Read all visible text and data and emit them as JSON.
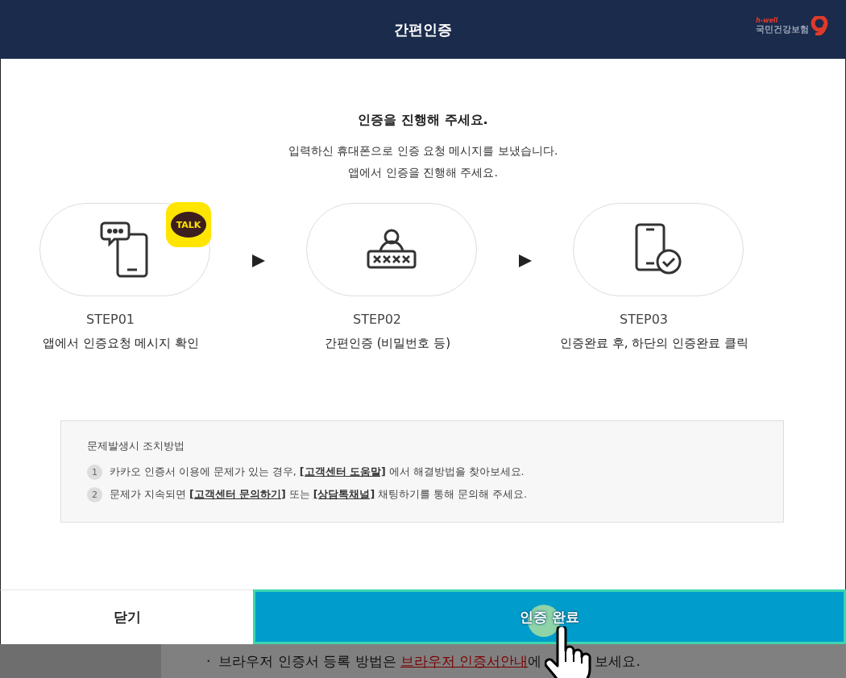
{
  "dialog": {
    "title": "간편인증",
    "logo": {
      "tagline": "h-well",
      "name": "국민건강보험"
    }
  },
  "intro": {
    "heading": "인증을 진행해 주세요.",
    "lines": [
      "입력하신 휴대폰으로 인증 요청 메시지를 보냈습니다.",
      "앱에서 인증을 진행해 주세요."
    ]
  },
  "steps": [
    {
      "kind": "message",
      "badge": "TALK",
      "label": "STEP01",
      "description": "앱에서 인증요청 메시지 확인"
    },
    {
      "kind": "password",
      "label": "STEP02",
      "description": "간편인증 (비밀번호 등)"
    },
    {
      "kind": "check",
      "label": "STEP03",
      "description": "인증완료 후, 하단의 인증완료 클릭"
    }
  ],
  "help": {
    "title": "문제발생시 조치방법",
    "items": [
      {
        "number": "1",
        "segments": [
          {
            "kind": "text",
            "text": "카카오 인증서 이용에 문제가 있는 경우, "
          },
          {
            "kind": "link",
            "text": "[고객센터 도움말]"
          },
          {
            "kind": "text",
            "text": " 에서 해결방법을 찾아보세요."
          }
        ]
      },
      {
        "number": "2",
        "segments": [
          {
            "kind": "text",
            "text": "문제가 지속되면 "
          },
          {
            "kind": "link",
            "text": "[고객센터 문의하기]"
          },
          {
            "kind": "text",
            "text": " 또는 "
          },
          {
            "kind": "link",
            "text": "[상담톡채널]"
          },
          {
            "kind": "text",
            "text": " 채팅하기를 통해 문의해 주세요."
          }
        ]
      }
    ]
  },
  "buttons": [
    {
      "kind": "secondary",
      "label": "닫기"
    },
    {
      "kind": "primary",
      "label": "인증 완료"
    }
  ],
  "background": {
    "bullet": "·",
    "before": "브라우저 인증서 등록 방법은 ",
    "link": "브라우저 인증서안내",
    "after": "에",
    "tail": "보세요."
  }
}
